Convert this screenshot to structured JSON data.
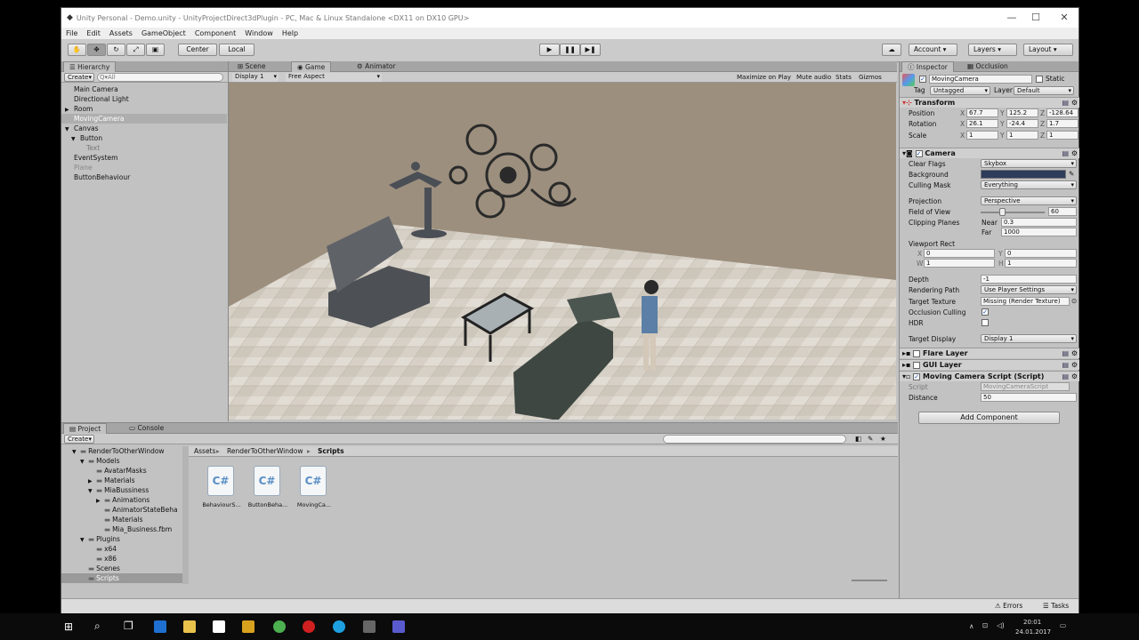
{
  "window": {
    "title": "Unity Personal - Demo.unity - UnityProjectDirect3dPlugin - PC, Mac & Linux Standalone <DX11 on DX10 GPU>",
    "minimize": "—",
    "maximize": "☐",
    "close": "✕"
  },
  "menu": [
    "File",
    "Edit",
    "Assets",
    "GameObject",
    "Component",
    "Window",
    "Help"
  ],
  "toolbar": {
    "pivot_center": "Center",
    "pivot_local": "Local",
    "play": "▶",
    "pause": "❚❚",
    "step": "▶❚",
    "account": "Account",
    "layers": "Layers",
    "layout": "Layout"
  },
  "hierarchy": {
    "tab": "Hierarchy",
    "create": "Create",
    "search_placeholder": "Q▾All",
    "items": [
      {
        "label": "Main Camera",
        "indent": 0,
        "arrow": ""
      },
      {
        "label": "Directional Light",
        "indent": 0,
        "arrow": ""
      },
      {
        "label": "Room",
        "indent": 0,
        "arrow": "▶"
      },
      {
        "label": "MovingCamera",
        "indent": 0,
        "arrow": ""
      },
      {
        "label": "Canvas",
        "indent": 0,
        "arrow": "▼"
      },
      {
        "label": "Button",
        "indent": 1,
        "arrow": "▼"
      },
      {
        "label": "Text",
        "indent": 2,
        "arrow": ""
      },
      {
        "label": "EventSystem",
        "indent": 0,
        "arrow": ""
      },
      {
        "label": "Plane",
        "indent": 0,
        "arrow": ""
      },
      {
        "label": "ButtonBehaviour",
        "indent": 0,
        "arrow": ""
      }
    ]
  },
  "scene_tabs": {
    "scene": "Scene",
    "game": "Game",
    "animator": "Animator"
  },
  "game_bar": {
    "display": "Display 1",
    "aspect": "Free Aspect",
    "maximize": "Maximize on Play",
    "mute": "Mute audio",
    "stats": "Stats",
    "gizmos": "Gizmos"
  },
  "inspector": {
    "tab": "Inspector",
    "tab2": "Occlusion",
    "object_name": "MovingCamera",
    "static": "Static",
    "tag_label": "Tag",
    "tag": "Untagged",
    "layer_label": "Layer",
    "layer": "Default",
    "transform": {
      "title": "Transform",
      "position_label": "Position",
      "rotation_label": "Rotation",
      "scale_label": "Scale",
      "position": [
        "67.7",
        "125.2",
        "-128.64"
      ],
      "rotation": [
        "26.1",
        "-24.4",
        "1.7"
      ],
      "scale": [
        "1",
        "1",
        "1"
      ]
    },
    "camera": {
      "title": "Camera",
      "clear_flags_label": "Clear Flags",
      "clear_flags": "Skybox",
      "background_label": "Background",
      "background_color": "#2e3c5c",
      "culling_label": "Culling Mask",
      "culling": "Everything",
      "projection_label": "Projection",
      "projection": "Perspective",
      "fov_label": "Field of View",
      "fov": "60",
      "fov_fraction": 0.33,
      "clipping_label": "Clipping Planes",
      "near_label": "Near",
      "near": "0.3",
      "far_label": "Far",
      "far": "1000",
      "viewport_label": "Viewport Rect",
      "vx": "0",
      "vy": "0",
      "vw": "1",
      "vh": "1",
      "depth_label": "Depth",
      "depth": "-1",
      "rendering_label": "Rendering Path",
      "rendering": "Use Player Settings",
      "target_label": "Target Texture",
      "target": "Missing (Render Texture)",
      "occlusion_label": "Occlusion Culling",
      "hdr_label": "HDR",
      "display_label": "Target Display",
      "display": "Display 1"
    },
    "flare": "Flare Layer",
    "gui": "GUI Layer",
    "script": {
      "title": "Moving Camera Script (Script)",
      "script_label": "Script",
      "script": "MovingCameraScript",
      "distance_label": "Distance",
      "distance": "50"
    },
    "add_component": "Add Component"
  },
  "project": {
    "tab": "Project",
    "tab2": "Console",
    "create": "Create",
    "breadcrumb": [
      "Assets",
      "RenderToOtherWindow",
      "Scripts"
    ],
    "tree": [
      {
        "label": "RenderToOtherWindow",
        "indent": 0,
        "arrow": "▼"
      },
      {
        "label": "Models",
        "indent": 1,
        "arrow": "▼"
      },
      {
        "label": "AvatarMasks",
        "indent": 2,
        "arrow": ""
      },
      {
        "label": "Materials",
        "indent": 2,
        "arrow": "▶"
      },
      {
        "label": "MiaBussiness",
        "indent": 2,
        "arrow": "▼"
      },
      {
        "label": "Animations",
        "indent": 3,
        "arrow": "▶"
      },
      {
        "label": "AnimatorStateBeha",
        "indent": 3,
        "arrow": ""
      },
      {
        "label": "Materials",
        "indent": 3,
        "arrow": ""
      },
      {
        "label": "Mia_Business.fbm",
        "indent": 3,
        "arrow": ""
      },
      {
        "label": "Plugins",
        "indent": 1,
        "arrow": "▼"
      },
      {
        "label": "x64",
        "indent": 2,
        "arrow": ""
      },
      {
        "label": "x86",
        "indent": 2,
        "arrow": ""
      },
      {
        "label": "Scenes",
        "indent": 1,
        "arrow": ""
      },
      {
        "label": "Scripts",
        "indent": 1,
        "arrow": ""
      }
    ],
    "files": [
      "BehaviourS...",
      "ButtonBeha...",
      "MovingCa..."
    ],
    "file_icon": "C#"
  },
  "statusbar": {
    "errors": "Errors",
    "tasks": "Tasks"
  },
  "taskbar": {
    "time": "20:01",
    "date": "24.01.2017"
  }
}
